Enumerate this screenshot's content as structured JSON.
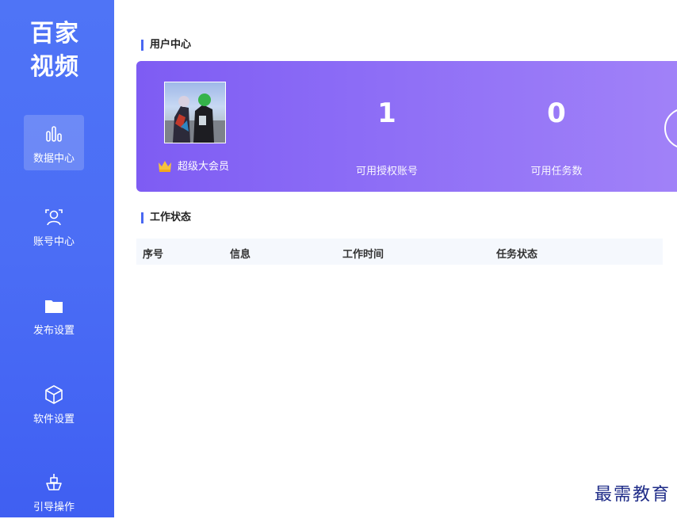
{
  "sidebar": {
    "brand_line1": "百家",
    "brand_line2": "视频",
    "items": [
      {
        "label": "数据中心",
        "icon": "bar-chart-icon",
        "active": true
      },
      {
        "label": "账号中心",
        "icon": "user-scan-icon"
      },
      {
        "label": "发布设置",
        "icon": "folder-icon"
      },
      {
        "label": "软件设置",
        "icon": "cube-icon"
      },
      {
        "label": "引导操作",
        "icon": "ship-icon"
      }
    ]
  },
  "user_center": {
    "title": "用户中心",
    "member_label": "超级大会员",
    "stats": [
      {
        "value": "1",
        "label": "可用授权账号"
      },
      {
        "value": "0",
        "label": "可用任务数"
      }
    ]
  },
  "work_status": {
    "title": "工作状态",
    "columns": [
      "序号",
      "信息",
      "工作时间",
      "任务状态"
    ]
  },
  "watermark": "最需教育",
  "colors": {
    "sidebar": "#4b6df5",
    "card_start": "#7e5cf3",
    "card_end": "#a182f8",
    "accent": "#4a68f2",
    "crown": "#f6c23e"
  }
}
